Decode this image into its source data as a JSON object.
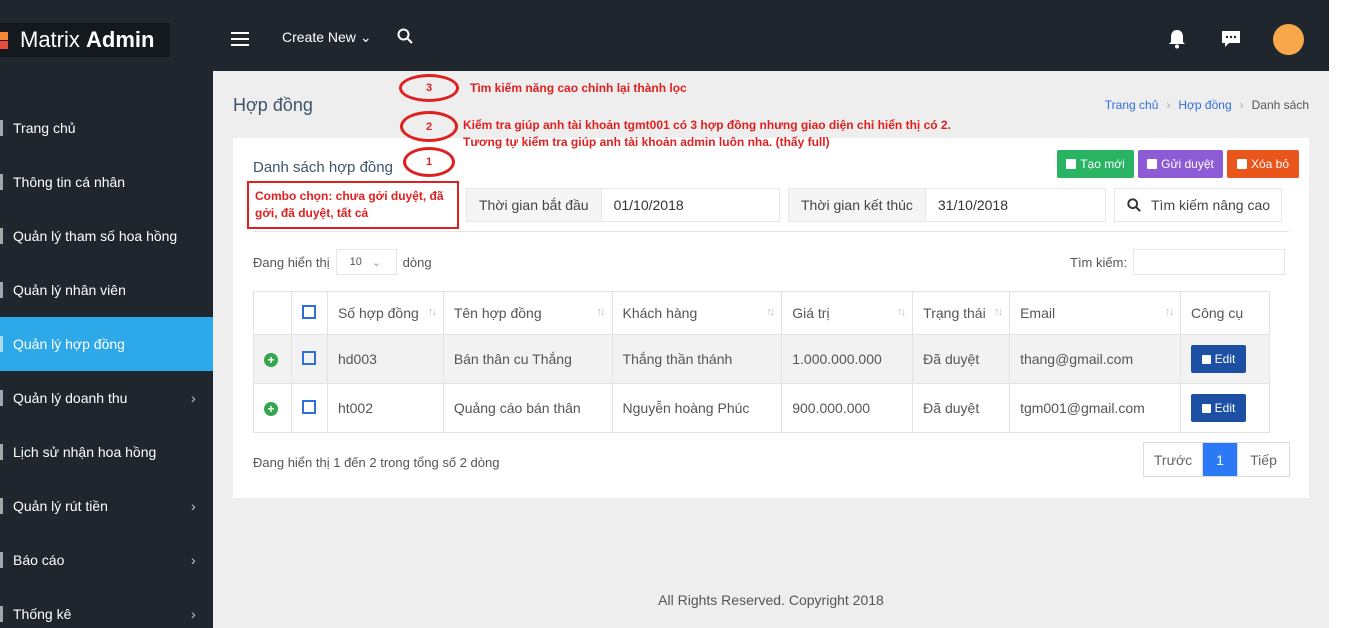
{
  "sidebar": {
    "logo_thin": "Matrix",
    "logo_bold": "Admin",
    "items": [
      {
        "label": "Trang chủ"
      },
      {
        "label": "Thông tin cá nhân"
      },
      {
        "label": "Quản lý tham số hoa hồng"
      },
      {
        "label": "Quản lý nhân viên"
      },
      {
        "label": "Quản lý hợp đồng"
      },
      {
        "label": "Quản lý doanh thu"
      },
      {
        "label": "Lịch sử nhận hoa hồng"
      },
      {
        "label": "Quản lý rút tiền"
      },
      {
        "label": "Báo cáo"
      },
      {
        "label": "Thống kê"
      }
    ]
  },
  "header": {
    "create_new": "Create New"
  },
  "page": {
    "title": "Hợp đồng",
    "breadcrumb": [
      "Trang chủ",
      "Hợp đồng",
      "Danh sách"
    ]
  },
  "card": {
    "title": "Danh sách hợp đồng",
    "btn_create": "Tạo mới",
    "btn_approve": "Gửi duyệt",
    "btn_delete": "Xóa bỏ",
    "start_label": "Thời gian bắt đầu",
    "start_value": "01/10/2018",
    "end_label": "Thời gian kết thúc",
    "end_value": "31/10/2018",
    "adv_search": "Tìm kiếm nâng cao",
    "show_prefix": "Đang hiển thị",
    "page_size": "10",
    "show_suffix": "dòng",
    "search_label": "Tìm kiếm:",
    "columns": [
      "Số hợp đồng",
      "Tên hợp đồng",
      "Khách hàng",
      "Giá trị",
      "Trạng thái",
      "Email",
      "Công cụ"
    ],
    "rows": [
      {
        "code": "hd003",
        "name": "Bán thân cu Thắng",
        "customer": "Thắng thần thánh",
        "value": "1.000.000.000",
        "status": "Đã duyệt",
        "email": "thang@gmail.com",
        "action": "Edit"
      },
      {
        "code": "ht002",
        "name": "Quảng cáo bán thân",
        "customer": "Nguyễn hoàng Phúc",
        "value": "900.000.000",
        "status": "Đã duyệt",
        "email": "tgm001@gmail.com",
        "action": "Edit"
      }
    ],
    "info": "Đang hiển thị 1 đến 2 trong tổng số 2 dòng",
    "pager": {
      "prev": "Trước",
      "current": "1",
      "next": "Tiếp"
    }
  },
  "footer": "All Rights Reserved. Copyright 2018",
  "annotations": {
    "n1": "1",
    "n2": "2",
    "n3": "3",
    "note3": "Tìm kiếm năng cao  chỉnh lại thành lọc",
    "note2a": "Kiểm tra giúp anh tài khoản tgmt001 có 3 hợp đồng nhưng giao diện chỉ hiển thị có 2.",
    "note2b": "Tương tự kiểm tra giúp anh tài khoản admin luôn nha. (thấy full)",
    "combo": "Combo chọn: chưa gởi duyệt, đã gởi, đã duyệt, tất cả"
  }
}
